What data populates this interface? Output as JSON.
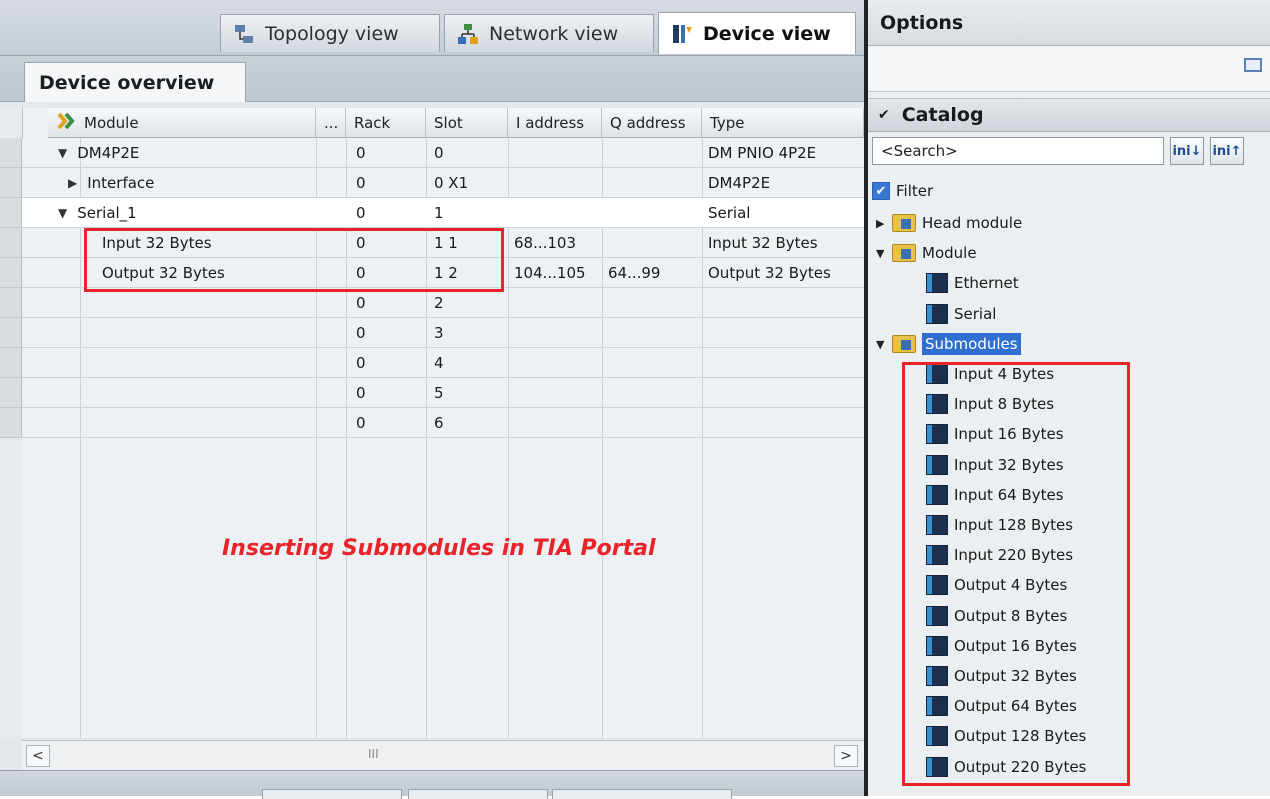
{
  "view_tabs": [
    {
      "label": "Topology view",
      "icon": "topology-icon"
    },
    {
      "label": "Network view",
      "icon": "network-icon"
    },
    {
      "label": "Device view",
      "icon": "device-icon",
      "active": true
    }
  ],
  "subtab": {
    "label": "Device overview"
  },
  "table": {
    "columns": [
      "Module",
      "...",
      "Rack",
      "Slot",
      "I address",
      "Q address",
      "Type"
    ],
    "rows": [
      {
        "module": "DM4P2E",
        "expander": "▼",
        "rack": "0",
        "slot": "0",
        "iaddr": "",
        "qaddr": "",
        "type": "DM PNIO 4P2E"
      },
      {
        "module": "Interface",
        "expander": "▶",
        "rack": "0",
        "slot": "0 X1",
        "iaddr": "",
        "qaddr": "",
        "type": "DM4P2E"
      },
      {
        "module": "Serial_1",
        "expander": "▼",
        "rack": "0",
        "slot": "1",
        "iaddr": "",
        "qaddr": "",
        "type": "Serial"
      },
      {
        "module": "Input 32 Bytes",
        "expander": "",
        "rack": "0",
        "slot": "1 1",
        "iaddr": "68...103",
        "qaddr": "",
        "type": "Input 32 Bytes"
      },
      {
        "module": "Output 32 Bytes",
        "expander": "",
        "rack": "0",
        "slot": "1 2",
        "iaddr": "104...105",
        "qaddr": "64...99",
        "type": "Output 32 Bytes"
      },
      {
        "module": "",
        "expander": "",
        "rack": "0",
        "slot": "2",
        "iaddr": "",
        "qaddr": "",
        "type": ""
      },
      {
        "module": "",
        "expander": "",
        "rack": "0",
        "slot": "3",
        "iaddr": "",
        "qaddr": "",
        "type": ""
      },
      {
        "module": "",
        "expander": "",
        "rack": "0",
        "slot": "4",
        "iaddr": "",
        "qaddr": "",
        "type": ""
      },
      {
        "module": "",
        "expander": "",
        "rack": "0",
        "slot": "5",
        "iaddr": "",
        "qaddr": "",
        "type": ""
      },
      {
        "module": "",
        "expander": "",
        "rack": "0",
        "slot": "6",
        "iaddr": "",
        "qaddr": "",
        "type": ""
      }
    ]
  },
  "caption": "Inserting Submodules in TIA Portal",
  "scrollbar": {
    "left": "<",
    "right": ">",
    "thumb": "III"
  },
  "options": {
    "title": "Options"
  },
  "catalog": {
    "title": "Catalog",
    "search_value": "<Search>",
    "filter_label": "Filter",
    "tree": [
      {
        "label": "Head module",
        "level": 0,
        "kind": "folder",
        "expander": "▶"
      },
      {
        "label": "Module",
        "level": 0,
        "kind": "folder",
        "expander": "▼"
      },
      {
        "label": "Ethernet",
        "level": 1,
        "kind": "module"
      },
      {
        "label": "Serial",
        "level": 1,
        "kind": "module"
      },
      {
        "label": "Submodules",
        "level": 0,
        "kind": "folder",
        "expander": "▼",
        "selected": true
      },
      {
        "label": "Input  4 Bytes",
        "level": 1,
        "kind": "module"
      },
      {
        "label": "Input  8 Bytes",
        "level": 1,
        "kind": "module"
      },
      {
        "label": "Input 16 Bytes",
        "level": 1,
        "kind": "module"
      },
      {
        "label": "Input 32 Bytes",
        "level": 1,
        "kind": "module"
      },
      {
        "label": "Input 64 Bytes",
        "level": 1,
        "kind": "module"
      },
      {
        "label": "Input 128 Bytes",
        "level": 1,
        "kind": "module"
      },
      {
        "label": "Input 220 Bytes",
        "level": 1,
        "kind": "module"
      },
      {
        "label": "Output  4 Bytes",
        "level": 1,
        "kind": "module"
      },
      {
        "label": "Output  8 Bytes",
        "level": 1,
        "kind": "module"
      },
      {
        "label": "Output 16 Bytes",
        "level": 1,
        "kind": "module"
      },
      {
        "label": "Output 32 Bytes",
        "level": 1,
        "kind": "module"
      },
      {
        "label": "Output 64 Bytes",
        "level": 1,
        "kind": "module"
      },
      {
        "label": "Output 128 Bytes",
        "level": 1,
        "kind": "module"
      },
      {
        "label": "Output 220 Bytes",
        "level": 1,
        "kind": "module"
      }
    ]
  },
  "colors": {
    "highlight_red": "#e8232a",
    "selection_blue": "#2f6fd0"
  }
}
